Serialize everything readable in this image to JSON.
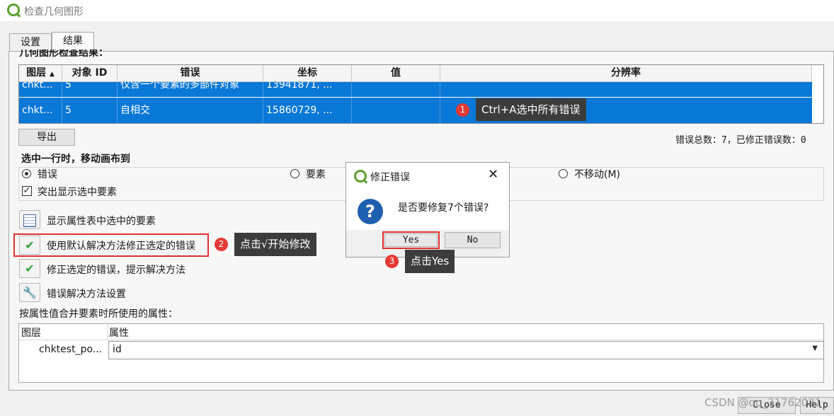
{
  "window": {
    "title": "检查几何图形"
  },
  "tabs": [
    {
      "label": "设置"
    },
    {
      "label": "结果"
    }
  ],
  "results": {
    "section_label": "几何图形检查结果：",
    "columns": [
      "图层",
      "对象 ID",
      "错误",
      "坐标",
      "值",
      "分辨率"
    ],
    "sort_icon": "sort-ascending-icon",
    "rows": [
      {
        "layer": "chkt...",
        "id": "5",
        "error": "仅含一个要素的多部件对象",
        "coord": "13941871, ...",
        "value": "",
        "resolution": ""
      },
      {
        "layer": "chkt...",
        "id": "5",
        "error": "自相交",
        "coord": "15860729, ...",
        "value": "",
        "resolution": ""
      }
    ],
    "selection_color": "#0a78d7"
  },
  "export_button": "导出",
  "error_summary": "错误总数：7，已修正错误数：0",
  "move_canvas": {
    "label": "选中一行时，移动画布到",
    "options": [
      "错误",
      "要素",
      "不移动(M)"
    ],
    "selected": "错误",
    "highlight_label": "突出显示选中要素"
  },
  "actions": [
    {
      "label": "显示属性表中选中的要素",
      "icon": "attribute-table-icon"
    },
    {
      "label": "使用默认解决方法修正选定的错误",
      "icon": "check-icon"
    },
    {
      "label": "修正选定的错误，提示解决方法",
      "icon": "check-icon"
    },
    {
      "label": "错误解决方法设置",
      "icon": "wrench-icon"
    }
  ],
  "merge_attr": {
    "label": "按属性值合并要素时所使用的属性：",
    "columns": [
      "图层",
      "属性"
    ],
    "layer_value": "chktest_po...",
    "attribute_value": "id"
  },
  "dialog": {
    "title": "修正错误",
    "message": "是否要修复7个错误?",
    "yes": "Yes",
    "no": "No",
    "icon": "question-icon"
  },
  "annotations": [
    {
      "num": "1",
      "text": "Ctrl+A选中所有错误"
    },
    {
      "num": "2",
      "text": "点击√开始修改"
    },
    {
      "num": "3",
      "text": "点击Yes"
    }
  ],
  "footer": {
    "close": "Close",
    "help": "Help",
    "watermark": "CSDN @qq_31762021"
  }
}
